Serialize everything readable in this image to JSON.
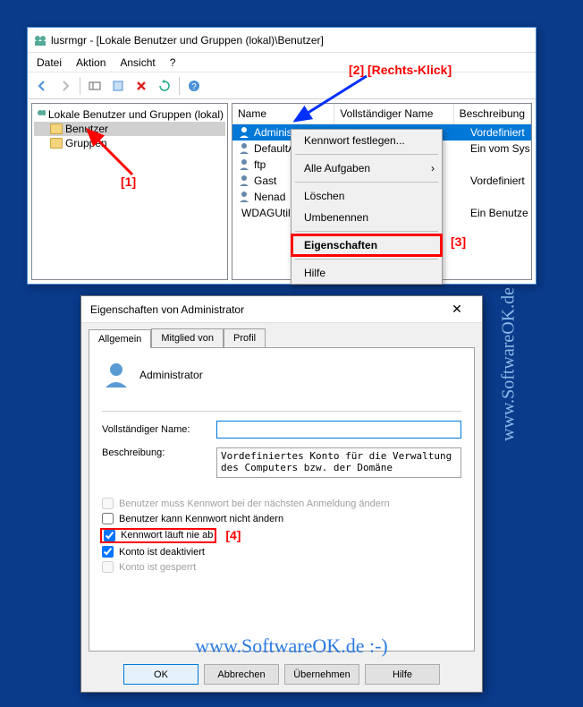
{
  "mmc": {
    "title": "lusrmgr - [Lokale Benutzer und Gruppen (lokal)\\Benutzer]",
    "menu": {
      "file": "Datei",
      "action": "Aktion",
      "view": "Ansicht",
      "help": "?"
    },
    "tree": {
      "root": "Lokale Benutzer und Gruppen (lokal)",
      "users": "Benutzer",
      "groups": "Gruppen"
    },
    "columns": {
      "name": "Name",
      "full": "Vollständiger Name",
      "desc": "Beschreibung"
    },
    "rows": [
      {
        "name": "Administrator",
        "full": "",
        "desc": "Vordefiniert"
      },
      {
        "name": "DefaultAccount",
        "full": "",
        "desc": "Ein vom Sys"
      },
      {
        "name": "ftp",
        "full": "",
        "desc": ""
      },
      {
        "name": "Gast",
        "full": "",
        "desc": "Vordefiniert"
      },
      {
        "name": "Nenad",
        "full": "",
        "desc": ""
      },
      {
        "name": "WDAGUtilityAccount",
        "full": "",
        "desc": "Ein Benutze"
      }
    ]
  },
  "context": {
    "setpw": "Kennwort festlegen...",
    "alltasks": "Alle Aufgaben",
    "delete": "Löschen",
    "rename": "Umbenennen",
    "props": "Eigenschaften",
    "help": "Hilfe"
  },
  "annotations": {
    "one": "[1]",
    "two": "[2] [Rechts-Klick]",
    "three": "[3]",
    "four": "[4]"
  },
  "props": {
    "title": "Eigenschaften von Administrator",
    "tabs": {
      "general": "Allgemein",
      "member": "Mitglied von",
      "profile": "Profil"
    },
    "username": "Administrator",
    "label_fullname": "Vollständiger Name:",
    "label_desc": "Beschreibung:",
    "val_fullname": "",
    "val_desc": "Vordefiniertes Konto für die Verwaltung des Computers bzw. der Domäne",
    "chk_mustchange": "Benutzer muss Kennwort bei der nächsten Anmeldung ändern",
    "chk_cannotchange": "Benutzer kann Kennwort nicht ändern",
    "chk_neverexpires": "Kennwort läuft nie ab",
    "chk_disabled": "Konto ist deaktiviert",
    "chk_locked": "Konto ist gesperrt",
    "btn_ok": "OK",
    "btn_cancel": "Abbrechen",
    "btn_apply": "Übernehmen",
    "btn_help": "Hilfe"
  },
  "watermark": "www.SoftwareOK.de :-)"
}
